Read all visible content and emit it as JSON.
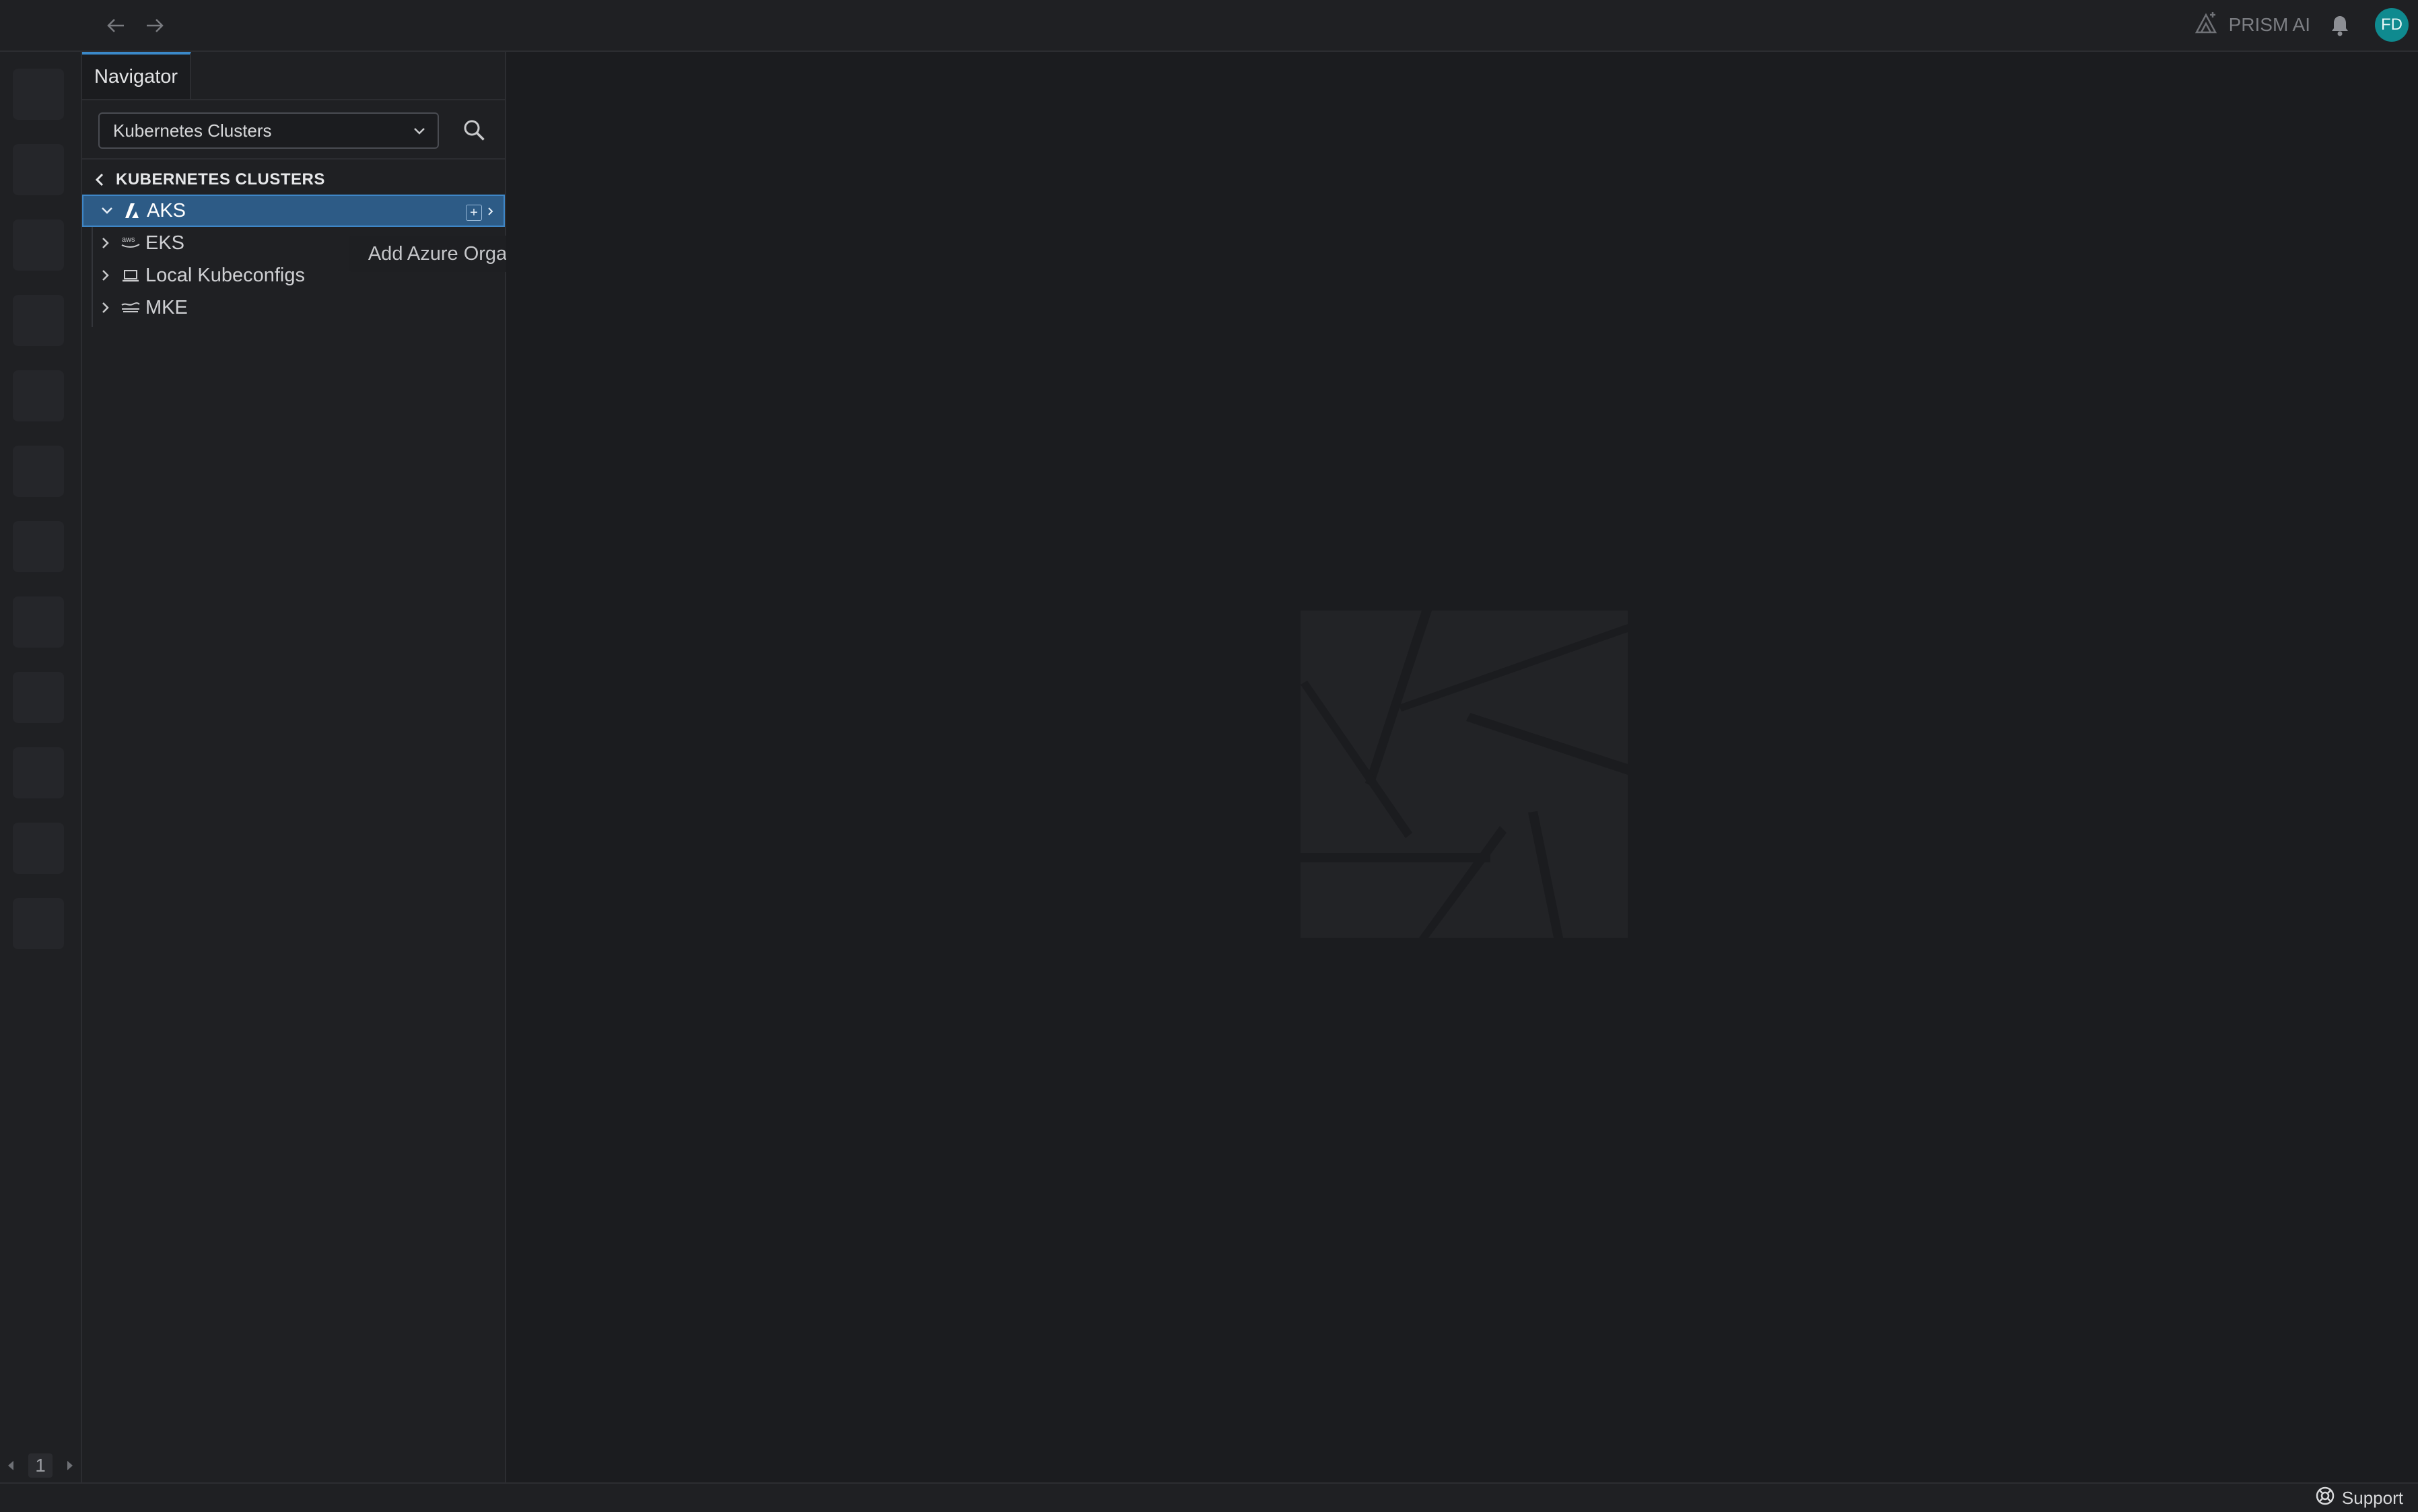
{
  "topbar": {
    "prism_label": "PRISM AI",
    "avatar_initials": "FD",
    "icons": [
      "back-arrow-icon",
      "forward-arrow-icon",
      "prism-ai-icon",
      "bell-icon"
    ]
  },
  "hotbar": {
    "slot_count": 12,
    "page_number": "1"
  },
  "sidebar": {
    "tab_label": "Navigator",
    "select": {
      "value": "Kubernetes Clusters"
    },
    "section_title": "KUBERNETES CLUSTERS",
    "tree": [
      {
        "label": "AKS",
        "expanded": true,
        "selected": true,
        "icon": "azure-icon"
      },
      {
        "label": "EKS",
        "expanded": false,
        "selected": false,
        "icon": "aws-icon"
      },
      {
        "label": "Local Kubeconfigs",
        "expanded": false,
        "selected": false,
        "icon": "laptop-icon"
      },
      {
        "label": "MKE",
        "expanded": false,
        "selected": false,
        "icon": "mke-icon"
      }
    ],
    "tooltip": "Add Azure Organization"
  },
  "statusbar": {
    "support_label": "Support"
  },
  "colors": {
    "background": "#1b1c1f",
    "panel": "#1f2023",
    "accent": "#3b89c9",
    "selected_row": "#2d5b86",
    "avatar": "#0f8a8f"
  }
}
